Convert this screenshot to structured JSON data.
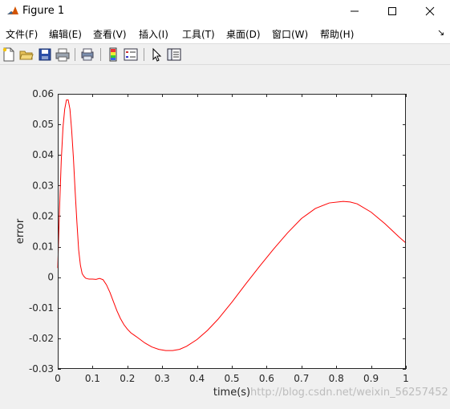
{
  "window": {
    "title": "Figure 1",
    "minimize_glyph": "─",
    "maximize_glyph": "☐",
    "close_glyph": "✕"
  },
  "menu": {
    "items": [
      "文件(F)",
      "编辑(E)",
      "查看(V)",
      "插入(I)",
      "工具(T)",
      "桌面(D)",
      "窗口(W)",
      "帮助(H)"
    ],
    "overflow_glyph": "↘"
  },
  "toolbar": {
    "buttons": [
      "new-figure-icon",
      "open-file-icon",
      "save-icon",
      "print-icon",
      "print-preview-icon",
      "colorbar-icon",
      "legend-icon",
      "pointer-icon",
      "property-inspector-icon"
    ]
  },
  "chart_data": {
    "type": "line",
    "xlabel": "time(s)",
    "ylabel": "error",
    "title": "",
    "xlim": [
      0,
      1
    ],
    "ylim": [
      -0.03,
      0.06
    ],
    "xticks": [
      "0",
      "0.1",
      "0.2",
      "0.3",
      "0.4",
      "0.5",
      "0.6",
      "0.7",
      "0.8",
      "0.9",
      "1"
    ],
    "yticks": [
      "-0.03",
      "-0.02",
      "-0.01",
      "0",
      "0.01",
      "0.02",
      "0.03",
      "0.04",
      "0.05",
      "0.06"
    ],
    "grid": false,
    "series": [
      {
        "color": "#ff0000",
        "x": [
          0,
          0.005,
          0.01,
          0.015,
          0.02,
          0.025,
          0.03,
          0.035,
          0.04,
          0.045,
          0.05,
          0.055,
          0.06,
          0.065,
          0.07,
          0.075,
          0.08,
          0.085,
          0.09,
          0.1,
          0.11,
          0.12,
          0.13,
          0.14,
          0.15,
          0.16,
          0.17,
          0.18,
          0.19,
          0.2,
          0.21,
          0.22,
          0.23,
          0.25,
          0.27,
          0.29,
          0.31,
          0.33,
          0.35,
          0.37,
          0.4,
          0.43,
          0.46,
          0.5,
          0.54,
          0.58,
          0.62,
          0.66,
          0.7,
          0.74,
          0.78,
          0.82,
          0.84,
          0.86,
          0.9,
          0.94,
          0.98,
          1.0
        ],
        "values": [
          0.003,
          0.022,
          0.038,
          0.049,
          0.055,
          0.058,
          0.058,
          0.055,
          0.048,
          0.039,
          0.028,
          0.018,
          0.009,
          0.004,
          0.0012,
          0.0003,
          -0.0003,
          -0.0005,
          -0.0006,
          -0.0006,
          -0.0007,
          -0.0004,
          -0.0008,
          -0.0025,
          -0.005,
          -0.008,
          -0.011,
          -0.0135,
          -0.0155,
          -0.017,
          -0.0182,
          -0.019,
          -0.0198,
          -0.0215,
          -0.0228,
          -0.0236,
          -0.024,
          -0.024,
          -0.0236,
          -0.0226,
          -0.0204,
          -0.0174,
          -0.0138,
          -0.0082,
          -0.0022,
          0.0036,
          0.0092,
          0.0145,
          0.0192,
          0.0225,
          0.0243,
          0.0248,
          0.0246,
          0.024,
          0.0213,
          0.0175,
          0.0132,
          0.0112
        ]
      }
    ]
  },
  "watermark": "http://blog.csdn.net/weixin_56257452"
}
